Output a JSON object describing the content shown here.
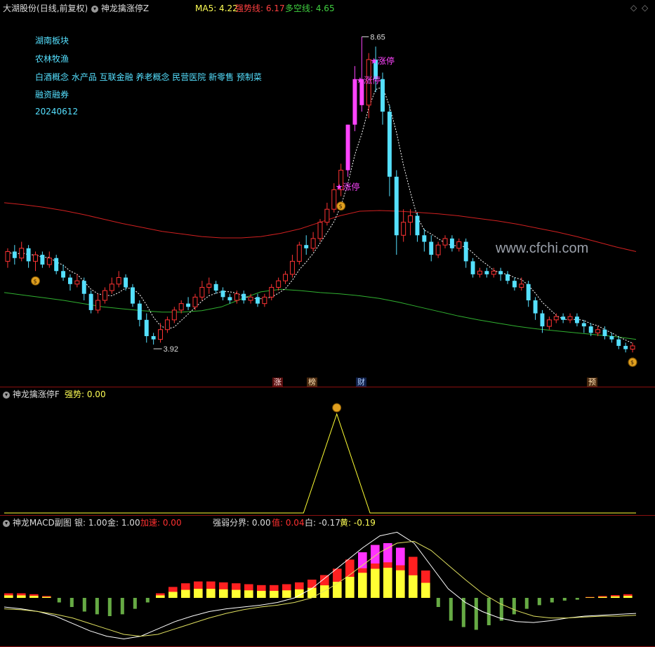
{
  "main_pane": {
    "stock_label": "大湖股份",
    "period_label": "(日线,前复权)",
    "indicator_name": "神龙擒涨停Z",
    "ma5_label": "MA5: 4.22",
    "strong_line_label": "强势线: 6.17",
    "bull_bear_label": "多空线: 4.65",
    "sectors": [
      "湖南板块",
      "农林牧渔",
      "白酒概念 水产品 互联金融 养老概念 民营医院 新零售 预制菜",
      "融资融券"
    ],
    "date": "20240612",
    "high_label": "8.65",
    "low_label": "3.92",
    "limit_up_label": "涨停",
    "watermark": "www.cfchi.com",
    "event_tags": [
      "涨",
      "榜",
      "财",
      "预"
    ]
  },
  "sub_pane1": {
    "indicator_name": "神龙擒涨停F",
    "strength_label": "强势: 0.00"
  },
  "sub_pane2": {
    "indicator_name": "神龙MACD副图",
    "silver_label": "银: 1.00",
    "gold_label": "金: 1.00",
    "accel_label": "加速: 0.00",
    "divide_label": "强弱分界: 0.00",
    "value_label": "值: 0.04",
    "white_label": "白: -0.17",
    "yellow_label": "黄: -0.19"
  },
  "colors": {
    "up": "#ff3333",
    "down": "#55e0ff",
    "limit_up": "#ff44ff",
    "strong_line": "#d02020",
    "bull_bear": "#30b030",
    "ma5": "#ffffff",
    "yellow": "#ffff33",
    "frame": "#8b1010"
  },
  "chart_data": [
    {
      "type": "candlestick",
      "title": "大湖股份 (日线,前复权)",
      "x_range": [
        0,
        169
      ],
      "y_range": [
        3.5,
        9.0
      ],
      "series": [
        {
          "name": "MA5",
          "values_note": "dashed"
        },
        {
          "name": "强势线",
          "values": [
            6.1,
            6.07,
            6.03,
            5.98,
            5.92,
            5.85,
            5.78,
            5.72,
            5.66,
            5.62,
            5.58,
            5.56,
            5.56,
            5.58,
            5.63,
            5.7,
            5.8,
            5.9,
            5.97,
            5.98,
            5.97,
            5.95,
            5.93,
            5.9,
            5.86,
            5.82,
            5.77,
            5.71,
            5.65,
            5.58,
            5.5,
            5.42,
            5.35
          ]
        },
        {
          "name": "多空线",
          "values": [
            4.72,
            4.68,
            4.64,
            4.6,
            4.55,
            4.5,
            4.47,
            4.44,
            4.42,
            4.42,
            4.44,
            4.5,
            4.62,
            4.73,
            4.77,
            4.75,
            4.72,
            4.7,
            4.67,
            4.63,
            4.57,
            4.5,
            4.43,
            4.36,
            4.3,
            4.25,
            4.2,
            4.16,
            4.13,
            4.1,
            4.07,
            4.04,
            4.0
          ]
        }
      ],
      "candles": [
        [
          5.2,
          5.35,
          5.4,
          5.1
        ],
        [
          5.35,
          5.25,
          5.45,
          5.15
        ],
        [
          5.25,
          5.4,
          5.5,
          5.2
        ],
        [
          5.4,
          5.2,
          5.45,
          5.1
        ],
        [
          5.2,
          5.3,
          5.35,
          5.05
        ],
        [
          5.3,
          5.15,
          5.35,
          5.1
        ],
        [
          5.15,
          5.25,
          5.35,
          5.1
        ],
        [
          5.25,
          5.05,
          5.3,
          5.0
        ],
        [
          5.05,
          4.95,
          5.15,
          4.9
        ],
        [
          4.95,
          4.85,
          5.0,
          4.75
        ],
        [
          4.85,
          4.9,
          5.0,
          4.8
        ],
        [
          4.9,
          4.7,
          4.95,
          4.6
        ],
        [
          4.7,
          4.45,
          4.75,
          4.4
        ],
        [
          4.45,
          4.6,
          4.7,
          4.4
        ],
        [
          4.6,
          4.75,
          4.8,
          4.55
        ],
        [
          4.75,
          4.85,
          4.95,
          4.7
        ],
        [
          4.85,
          4.95,
          5.05,
          4.8
        ],
        [
          4.95,
          4.8,
          5.0,
          4.75
        ],
        [
          4.8,
          4.55,
          4.85,
          4.5
        ],
        [
          4.55,
          4.3,
          4.6,
          4.2
        ],
        [
          4.3,
          4.05,
          4.4,
          3.95
        ],
        [
          4.05,
          4.0,
          4.1,
          3.92
        ],
        [
          4.0,
          4.15,
          4.25,
          3.95
        ],
        [
          4.15,
          4.3,
          4.35,
          4.1
        ],
        [
          4.3,
          4.45,
          4.5,
          4.25
        ],
        [
          4.45,
          4.55,
          4.6,
          4.4
        ],
        [
          4.55,
          4.5,
          4.65,
          4.45
        ],
        [
          4.5,
          4.65,
          4.7,
          4.45
        ],
        [
          4.65,
          4.8,
          4.9,
          4.6
        ],
        [
          4.8,
          4.85,
          4.95,
          4.7
        ],
        [
          4.85,
          4.75,
          4.9,
          4.7
        ],
        [
          4.75,
          4.65,
          4.8,
          4.6
        ],
        [
          4.65,
          4.6,
          4.7,
          4.55
        ],
        [
          4.6,
          4.7,
          4.75,
          4.55
        ],
        [
          4.7,
          4.6,
          4.75,
          4.55
        ],
        [
          4.6,
          4.65,
          4.7,
          4.55
        ],
        [
          4.65,
          4.55,
          4.7,
          4.5
        ],
        [
          4.55,
          4.65,
          4.7,
          4.5
        ],
        [
          4.65,
          4.8,
          4.85,
          4.6
        ],
        [
          4.8,
          4.9,
          4.95,
          4.75
        ],
        [
          4.9,
          5.0,
          5.05,
          4.85
        ],
        [
          5.0,
          5.2,
          5.3,
          4.95
        ],
        [
          5.2,
          5.45,
          5.5,
          5.15
        ],
        [
          5.45,
          5.4,
          5.6,
          5.3
        ],
        [
          5.4,
          5.55,
          5.65,
          5.35
        ],
        [
          5.55,
          5.8,
          5.85,
          5.5
        ],
        [
          5.8,
          6.0,
          6.1,
          5.75
        ],
        [
          6.0,
          6.3,
          6.4,
          5.95
        ],
        [
          6.3,
          6.6,
          6.7,
          6.2
        ],
        [
          6.6,
          7.3,
          7.3,
          6.5
        ],
        [
          7.3,
          8.0,
          8.2,
          7.2
        ],
        [
          8.0,
          7.6,
          8.65,
          7.5
        ],
        [
          7.6,
          8.3,
          8.4,
          7.4
        ],
        [
          8.3,
          8.0,
          8.5,
          7.8
        ],
        [
          8.0,
          7.5,
          8.1,
          7.3
        ],
        [
          7.5,
          6.5,
          7.6,
          6.2
        ],
        [
          6.5,
          5.6,
          6.6,
          5.3
        ],
        [
          5.6,
          5.8,
          6.0,
          5.5
        ],
        [
          5.8,
          5.9,
          6.0,
          5.6
        ],
        [
          5.9,
          5.6,
          5.95,
          5.5
        ],
        [
          5.6,
          5.5,
          5.7,
          5.35
        ],
        [
          5.5,
          5.3,
          5.6,
          5.2
        ],
        [
          5.3,
          5.45,
          5.5,
          5.25
        ],
        [
          5.45,
          5.55,
          5.6,
          5.4
        ],
        [
          5.55,
          5.4,
          5.6,
          5.35
        ],
        [
          5.4,
          5.5,
          5.55,
          5.35
        ],
        [
          5.5,
          5.2,
          5.55,
          5.1
        ],
        [
          5.2,
          5.0,
          5.25,
          4.95
        ],
        [
          5.0,
          5.05,
          5.1,
          4.95
        ],
        [
          5.05,
          5.0,
          5.1,
          4.95
        ],
        [
          5.0,
          5.05,
          5.1,
          4.95
        ],
        [
          5.05,
          5.0,
          5.1,
          4.9
        ],
        [
          5.0,
          4.9,
          5.05,
          4.85
        ],
        [
          4.9,
          4.8,
          4.95,
          4.75
        ],
        [
          4.8,
          4.85,
          4.95,
          4.75
        ],
        [
          4.85,
          4.6,
          4.9,
          4.5
        ],
        [
          4.6,
          4.4,
          4.65,
          4.3
        ],
        [
          4.4,
          4.2,
          4.45,
          4.1
        ],
        [
          4.2,
          4.3,
          4.35,
          4.15
        ],
        [
          4.3,
          4.35,
          4.4,
          4.25
        ],
        [
          4.35,
          4.3,
          4.4,
          4.25
        ],
        [
          4.3,
          4.35,
          4.4,
          4.25
        ],
        [
          4.35,
          4.25,
          4.4,
          4.2
        ],
        [
          4.25,
          4.2,
          4.3,
          4.1
        ],
        [
          4.2,
          4.1,
          4.25,
          4.05
        ],
        [
          4.1,
          4.15,
          4.2,
          4.05
        ],
        [
          4.15,
          4.05,
          4.2,
          4.0
        ],
        [
          4.05,
          4.0,
          4.1,
          3.95
        ],
        [
          4.0,
          3.9,
          4.05,
          3.85
        ],
        [
          3.9,
          3.85,
          3.95,
          3.8
        ],
        [
          3.85,
          3.9,
          3.95,
          3.8
        ]
      ]
    },
    {
      "type": "line",
      "title": "神龙擒涨停F",
      "series": [
        {
          "name": "强势",
          "values": [
            0,
            0,
            0,
            0,
            0,
            0,
            0,
            0,
            0,
            0,
            1,
            0,
            0,
            0,
            0,
            0,
            0,
            0,
            0,
            0
          ]
        }
      ]
    },
    {
      "type": "bar",
      "title": "神龙MACD副图",
      "series": [
        {
          "name": "值",
          "values": [
            0.05,
            0.05,
            0.04,
            0.02,
            -0.05,
            -0.1,
            -0.15,
            -0.18,
            -0.2,
            -0.18,
            -0.12,
            -0.05,
            0.05,
            0.12,
            0.16,
            0.18,
            0.18,
            0.17,
            0.16,
            0.15,
            0.14,
            0.14,
            0.15,
            0.17,
            0.2,
            0.25,
            0.32,
            0.42,
            0.5,
            0.58,
            0.6,
            0.55,
            0.45,
            0.3,
            -0.1,
            -0.25,
            -0.32,
            -0.35,
            -0.3,
            -0.25,
            -0.18,
            -0.12,
            -0.08,
            -0.05,
            -0.03,
            -0.02,
            0.01,
            0.02,
            0.03,
            0.04
          ]
        },
        {
          "name": "白",
          "values": [
            -0.1,
            -0.12,
            -0.15,
            -0.2,
            -0.28,
            -0.36,
            -0.42,
            -0.45,
            -0.42,
            -0.34,
            -0.26,
            -0.2,
            -0.15,
            -0.12,
            -0.1,
            -0.08,
            -0.05,
            0.0,
            0.1,
            0.25,
            0.4,
            0.55,
            0.68,
            0.72,
            0.6,
            0.35,
            0.1,
            -0.05,
            -0.15,
            -0.22,
            -0.26,
            -0.27,
            -0.25,
            -0.22,
            -0.2,
            -0.19,
            -0.18,
            -0.17
          ]
        },
        {
          "name": "黄",
          "values": [
            -0.12,
            -0.13,
            -0.15,
            -0.18,
            -0.22,
            -0.28,
            -0.34,
            -0.4,
            -0.42,
            -0.4,
            -0.34,
            -0.28,
            -0.22,
            -0.17,
            -0.13,
            -0.1,
            -0.08,
            -0.05,
            0.0,
            0.1,
            0.22,
            0.36,
            0.5,
            0.6,
            0.62,
            0.52,
            0.36,
            0.2,
            0.05,
            -0.06,
            -0.14,
            -0.2,
            -0.22,
            -0.22,
            -0.21,
            -0.2,
            -0.2,
            -0.19
          ]
        }
      ]
    }
  ]
}
